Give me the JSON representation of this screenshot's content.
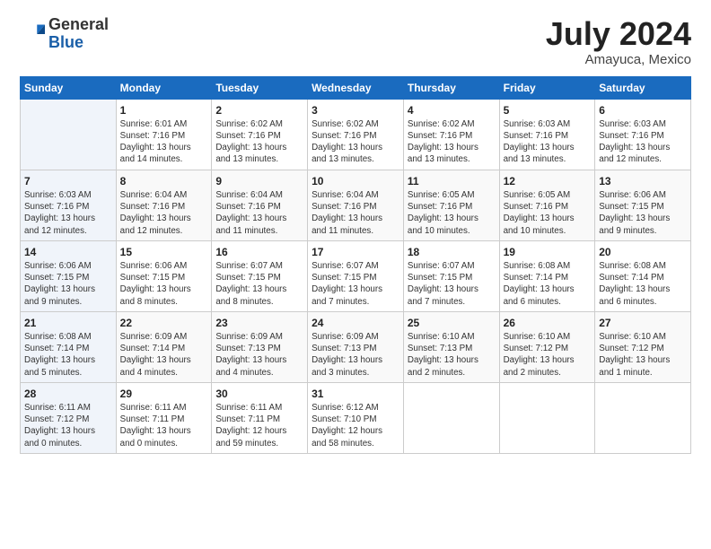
{
  "header": {
    "logo_general": "General",
    "logo_blue": "Blue",
    "month_title": "July 2024",
    "location": "Amayuca, Mexico"
  },
  "days_of_week": [
    "Sunday",
    "Monday",
    "Tuesday",
    "Wednesday",
    "Thursday",
    "Friday",
    "Saturday"
  ],
  "weeks": [
    [
      {
        "day": "",
        "info": ""
      },
      {
        "day": "1",
        "info": "Sunrise: 6:01 AM\nSunset: 7:16 PM\nDaylight: 13 hours\nand 14 minutes."
      },
      {
        "day": "2",
        "info": "Sunrise: 6:02 AM\nSunset: 7:16 PM\nDaylight: 13 hours\nand 13 minutes."
      },
      {
        "day": "3",
        "info": "Sunrise: 6:02 AM\nSunset: 7:16 PM\nDaylight: 13 hours\nand 13 minutes."
      },
      {
        "day": "4",
        "info": "Sunrise: 6:02 AM\nSunset: 7:16 PM\nDaylight: 13 hours\nand 13 minutes."
      },
      {
        "day": "5",
        "info": "Sunrise: 6:03 AM\nSunset: 7:16 PM\nDaylight: 13 hours\nand 13 minutes."
      },
      {
        "day": "6",
        "info": "Sunrise: 6:03 AM\nSunset: 7:16 PM\nDaylight: 13 hours\nand 12 minutes."
      }
    ],
    [
      {
        "day": "7",
        "info": "Sunrise: 6:03 AM\nSunset: 7:16 PM\nDaylight: 13 hours\nand 12 minutes."
      },
      {
        "day": "8",
        "info": "Sunrise: 6:04 AM\nSunset: 7:16 PM\nDaylight: 13 hours\nand 12 minutes."
      },
      {
        "day": "9",
        "info": "Sunrise: 6:04 AM\nSunset: 7:16 PM\nDaylight: 13 hours\nand 11 minutes."
      },
      {
        "day": "10",
        "info": "Sunrise: 6:04 AM\nSunset: 7:16 PM\nDaylight: 13 hours\nand 11 minutes."
      },
      {
        "day": "11",
        "info": "Sunrise: 6:05 AM\nSunset: 7:16 PM\nDaylight: 13 hours\nand 10 minutes."
      },
      {
        "day": "12",
        "info": "Sunrise: 6:05 AM\nSunset: 7:16 PM\nDaylight: 13 hours\nand 10 minutes."
      },
      {
        "day": "13",
        "info": "Sunrise: 6:06 AM\nSunset: 7:15 PM\nDaylight: 13 hours\nand 9 minutes."
      }
    ],
    [
      {
        "day": "14",
        "info": "Sunrise: 6:06 AM\nSunset: 7:15 PM\nDaylight: 13 hours\nand 9 minutes."
      },
      {
        "day": "15",
        "info": "Sunrise: 6:06 AM\nSunset: 7:15 PM\nDaylight: 13 hours\nand 8 minutes."
      },
      {
        "day": "16",
        "info": "Sunrise: 6:07 AM\nSunset: 7:15 PM\nDaylight: 13 hours\nand 8 minutes."
      },
      {
        "day": "17",
        "info": "Sunrise: 6:07 AM\nSunset: 7:15 PM\nDaylight: 13 hours\nand 7 minutes."
      },
      {
        "day": "18",
        "info": "Sunrise: 6:07 AM\nSunset: 7:15 PM\nDaylight: 13 hours\nand 7 minutes."
      },
      {
        "day": "19",
        "info": "Sunrise: 6:08 AM\nSunset: 7:14 PM\nDaylight: 13 hours\nand 6 minutes."
      },
      {
        "day": "20",
        "info": "Sunrise: 6:08 AM\nSunset: 7:14 PM\nDaylight: 13 hours\nand 6 minutes."
      }
    ],
    [
      {
        "day": "21",
        "info": "Sunrise: 6:08 AM\nSunset: 7:14 PM\nDaylight: 13 hours\nand 5 minutes."
      },
      {
        "day": "22",
        "info": "Sunrise: 6:09 AM\nSunset: 7:14 PM\nDaylight: 13 hours\nand 4 minutes."
      },
      {
        "day": "23",
        "info": "Sunrise: 6:09 AM\nSunset: 7:13 PM\nDaylight: 13 hours\nand 4 minutes."
      },
      {
        "day": "24",
        "info": "Sunrise: 6:09 AM\nSunset: 7:13 PM\nDaylight: 13 hours\nand 3 minutes."
      },
      {
        "day": "25",
        "info": "Sunrise: 6:10 AM\nSunset: 7:13 PM\nDaylight: 13 hours\nand 2 minutes."
      },
      {
        "day": "26",
        "info": "Sunrise: 6:10 AM\nSunset: 7:12 PM\nDaylight: 13 hours\nand 2 minutes."
      },
      {
        "day": "27",
        "info": "Sunrise: 6:10 AM\nSunset: 7:12 PM\nDaylight: 13 hours\nand 1 minute."
      }
    ],
    [
      {
        "day": "28",
        "info": "Sunrise: 6:11 AM\nSunset: 7:12 PM\nDaylight: 13 hours\nand 0 minutes."
      },
      {
        "day": "29",
        "info": "Sunrise: 6:11 AM\nSunset: 7:11 PM\nDaylight: 13 hours\nand 0 minutes."
      },
      {
        "day": "30",
        "info": "Sunrise: 6:11 AM\nSunset: 7:11 PM\nDaylight: 12 hours\nand 59 minutes."
      },
      {
        "day": "31",
        "info": "Sunrise: 6:12 AM\nSunset: 7:10 PM\nDaylight: 12 hours\nand 58 minutes."
      },
      {
        "day": "",
        "info": ""
      },
      {
        "day": "",
        "info": ""
      },
      {
        "day": "",
        "info": ""
      }
    ]
  ]
}
